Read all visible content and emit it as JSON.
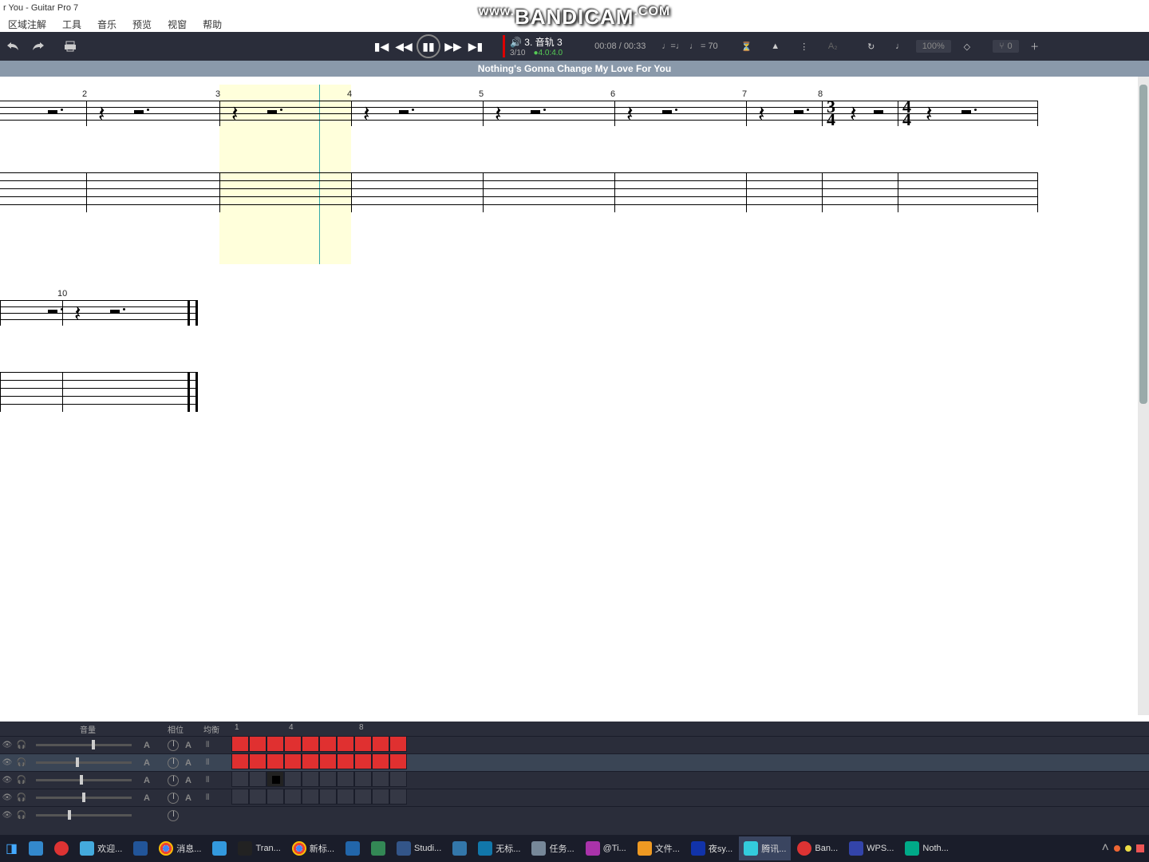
{
  "app": {
    "title": "r You - Guitar Pro 7"
  },
  "menu": [
    "区域注解",
    "工具",
    "音乐",
    "预览",
    "视窗",
    "帮助"
  ],
  "watermark": {
    "prefix": "www.",
    "main": "BANDICAM",
    "suffix": ".COM"
  },
  "transport": {
    "track_label": "3. 音轨 3",
    "bar_pos": "3/10",
    "beat_pos": "4.0:4.0",
    "time_cur": "00:08",
    "time_tot": "00:33",
    "tempo_eq": "♩=♩",
    "tempo_val": "♩ = 70",
    "zoom": "100%",
    "fret": "0"
  },
  "song": {
    "title": "Nothing's Gonna Change My Love For You"
  },
  "score": {
    "row1_bars": [
      2,
      3,
      4,
      5,
      6,
      7,
      8
    ],
    "row2_bars": [
      10
    ],
    "timesig_7": {
      "n": "3",
      "d": "4"
    },
    "timesig_8": {
      "n": "4",
      "d": "4"
    }
  },
  "trackpanel": {
    "col_vol": "音量",
    "col_pan": "相位",
    "col_eq": "均衡",
    "grid_marks": [
      "1",
      "4",
      "8"
    ],
    "rows": [
      {
        "sel": false,
        "vol": 70
      },
      {
        "sel": true,
        "vol": 50
      },
      {
        "sel": false,
        "vol": 55
      },
      {
        "sel": false,
        "vol": 58
      },
      {
        "sel": false,
        "vol": 40
      }
    ]
  },
  "taskbar": {
    "items": [
      {
        "ico": "#38c",
        "txt": ""
      },
      {
        "ico": "#d33",
        "txt": "",
        "round": true
      },
      {
        "ico": "#4ad",
        "txt": "欢迎..."
      },
      {
        "ico": "#259",
        "txt": ""
      },
      {
        "ico": "#fff",
        "txt": "消息...",
        "chrome": true
      },
      {
        "ico": "#39d",
        "txt": ""
      },
      {
        "ico": "#222",
        "txt": "Tran..."
      },
      {
        "ico": "#fff",
        "txt": "新标...",
        "chrome": true
      },
      {
        "ico": "#26a",
        "txt": ""
      },
      {
        "ico": "#385",
        "txt": ""
      },
      {
        "ico": "#358",
        "txt": "Studi..."
      },
      {
        "ico": "#37a",
        "txt": ""
      },
      {
        "ico": "#17a",
        "txt": "无标..."
      },
      {
        "ico": "#789",
        "txt": "任务..."
      },
      {
        "ico": "#a3a",
        "txt": "@Ti..."
      },
      {
        "ico": "#e92",
        "txt": "文件..."
      },
      {
        "ico": "#13a",
        "txt": "夜sy..."
      },
      {
        "ico": "#3cd",
        "txt": "腾讯...",
        "active": true
      },
      {
        "ico": "#d33",
        "txt": "Ban...",
        "round": true
      },
      {
        "ico": "#34a",
        "txt": "WPS..."
      },
      {
        "ico": "#0a8",
        "txt": "Noth..."
      }
    ]
  }
}
